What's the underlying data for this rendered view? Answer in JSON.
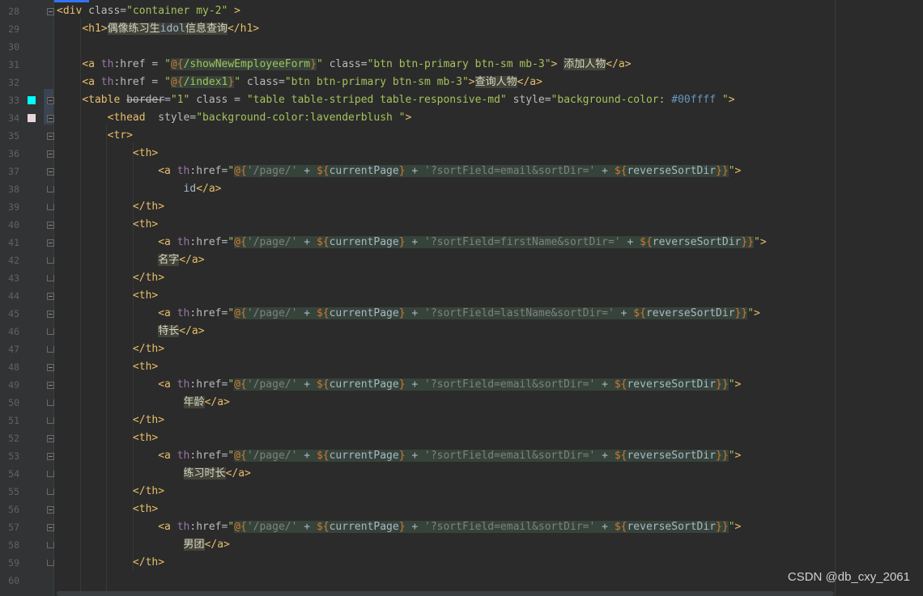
{
  "editor": {
    "colors": {
      "background": "#2b2b2b",
      "gutter": "#313335",
      "tag": "#e8bf6a",
      "string": "#a5c25c",
      "th_prefix": "#9876aa",
      "swatch_cyan": "#00ffff",
      "swatch_lavenderblush": "#fff0f5"
    },
    "lines": [
      {
        "num": "28"
      },
      {
        "num": "29"
      },
      {
        "num": "30"
      },
      {
        "num": "31"
      },
      {
        "num": "32"
      },
      {
        "num": "33"
      },
      {
        "num": "34"
      },
      {
        "num": "35"
      },
      {
        "num": "36"
      },
      {
        "num": "37"
      },
      {
        "num": "38"
      },
      {
        "num": "39"
      },
      {
        "num": "40"
      },
      {
        "num": "41"
      },
      {
        "num": "42"
      },
      {
        "num": "43"
      },
      {
        "num": "44"
      },
      {
        "num": "45"
      },
      {
        "num": "46"
      },
      {
        "num": "47"
      },
      {
        "num": "48"
      },
      {
        "num": "49"
      },
      {
        "num": "50"
      },
      {
        "num": "51"
      },
      {
        "num": "52"
      },
      {
        "num": "53"
      },
      {
        "num": "54"
      },
      {
        "num": "55"
      },
      {
        "num": "56"
      },
      {
        "num": "57"
      },
      {
        "num": "58"
      },
      {
        "num": "59"
      },
      {
        "num": "60"
      }
    ],
    "tokens": {
      "div_open": "<div ",
      "attr_class": "class",
      "eq": "=",
      "str_container": "\"container my-2\"",
      "gt_space": " >",
      "gt": ">",
      "h1_open": "<h1>",
      "h1_text_a": "偶像练习生",
      "h1_text_b": "idol",
      "h1_text_c": "信息查询",
      "h1_close": "</h1>",
      "a_open": "<a ",
      "th_prefix": "th",
      "href_attr": ":href",
      "eq_spaced": " = ",
      "q_open": "\"",
      "at_brace": "@{",
      "url_form": "/showNewEmployeeForm",
      "brace_close": "}",
      "url_index": "/index1",
      "q_close": "\"",
      "class_eq": " class=",
      "str_btn": "\"btn btn-primary btn-sm mb-3\"",
      "add_person": "添加人物",
      "query_person": "查询人物",
      "a_close": "</a>",
      "table_open": "<table ",
      "border_attr": "border",
      "str_one": "\"1\"",
      "class_eq_spaced": " class = ",
      "str_table_class": "\"table table-striped table-responsive-md\"",
      "style_eq": " style=",
      "str_style_open": "\"background-color: ",
      "hex_cyan": "#00ffff",
      "str_style_close": " \"",
      "thead_open": "<thead ",
      "style_eq2": " style=",
      "str_thead_style": "\"background-color:lavenderblush \"",
      "tr_open": "<tr>",
      "th_open": "<th>",
      "th_close": "</th>",
      "page_lit": "'/page/'",
      "plus": " + ",
      "dollar_brace": "${",
      "current_page": "currentPage",
      "reverse_sort": "reverseSortDir",
      "close_brace": "}",
      "close_braces": "}}",
      "sort_email": "'?sortField=email&sortDir='",
      "sort_first": "'?sortField=firstName&sortDir='",
      "sort_last": "'?sortField=lastName&sortDir='",
      "at_open": "@{",
      "txt_id": "id",
      "txt_name": "名字",
      "txt_skill": "特长",
      "txt_age": "年龄",
      "txt_practice": "练习时长",
      "txt_group": "男团"
    }
  },
  "watermark": "CSDN @db_cxy_2061"
}
